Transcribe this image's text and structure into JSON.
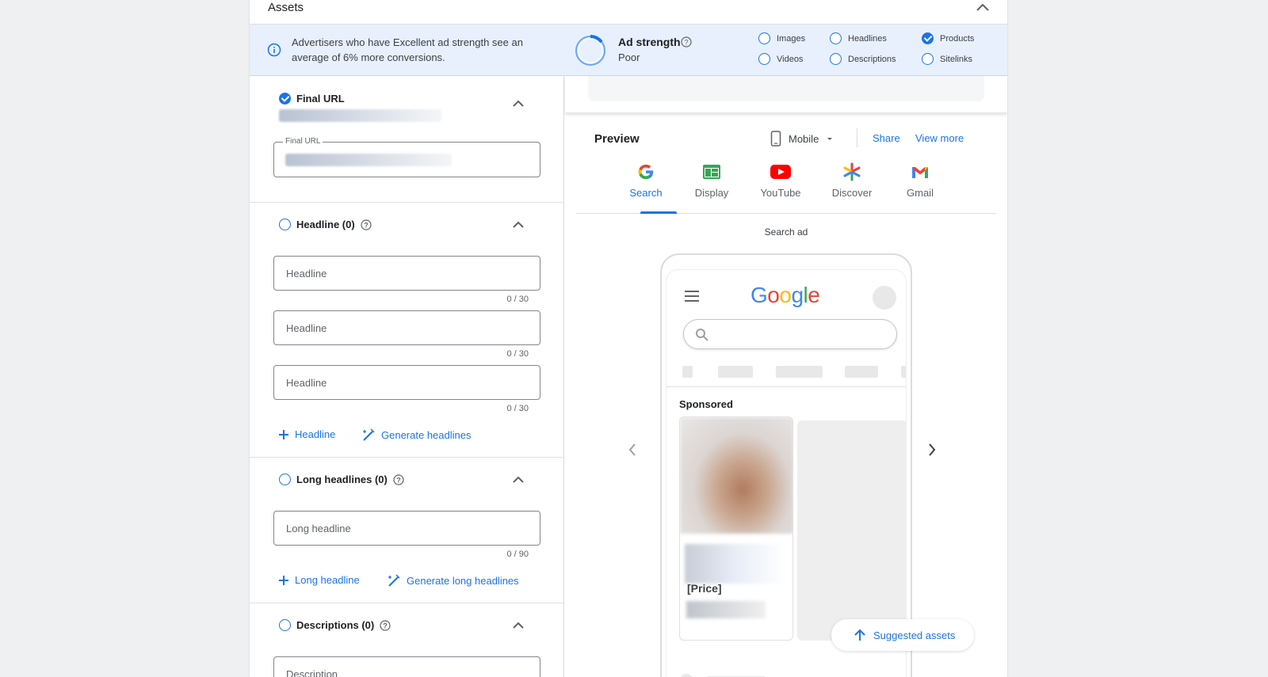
{
  "assets": {
    "title": "Assets"
  },
  "banner": {
    "message": "Advertisers who have Excellent ad strength see an average of 6% more conversions.",
    "ad_strength_label": "Ad strength",
    "ad_strength_value": "Poor",
    "checklist": [
      {
        "label": "Images",
        "checked": false
      },
      {
        "label": "Headlines",
        "checked": false
      },
      {
        "label": "Products",
        "checked": true
      },
      {
        "label": "Videos",
        "checked": false
      },
      {
        "label": "Descriptions",
        "checked": false
      },
      {
        "label": "Sitelinks",
        "checked": false
      }
    ]
  },
  "final_url": {
    "heading": "Final URL",
    "field_label": "Final URL"
  },
  "headlines": {
    "heading": "Headline (0)",
    "placeholder": "Headline",
    "counter": "0 / 30",
    "add_label": "Headline",
    "generate_label": "Generate headlines"
  },
  "long_headlines": {
    "heading": "Long headlines (0)",
    "placeholder": "Long headline",
    "counter": "0 / 90",
    "add_label": "Long headline",
    "generate_label": "Generate long headlines"
  },
  "descriptions": {
    "heading": "Descriptions (0)",
    "placeholder": "Description"
  },
  "preview": {
    "title": "Preview",
    "device": "Mobile",
    "share": "Share",
    "view_more": "View more",
    "tabs": [
      "Search",
      "Display",
      "YouTube",
      "Discover",
      "Gmail"
    ],
    "active_tab": "Search",
    "ad_type": "Search ad",
    "google_logo": "Google",
    "sponsored": "Sponsored",
    "price": "[Price]",
    "suggested": "Suggested assets"
  },
  "colors": {
    "accent": "#1a73e8",
    "banner_bg": "#e8f0fe"
  }
}
